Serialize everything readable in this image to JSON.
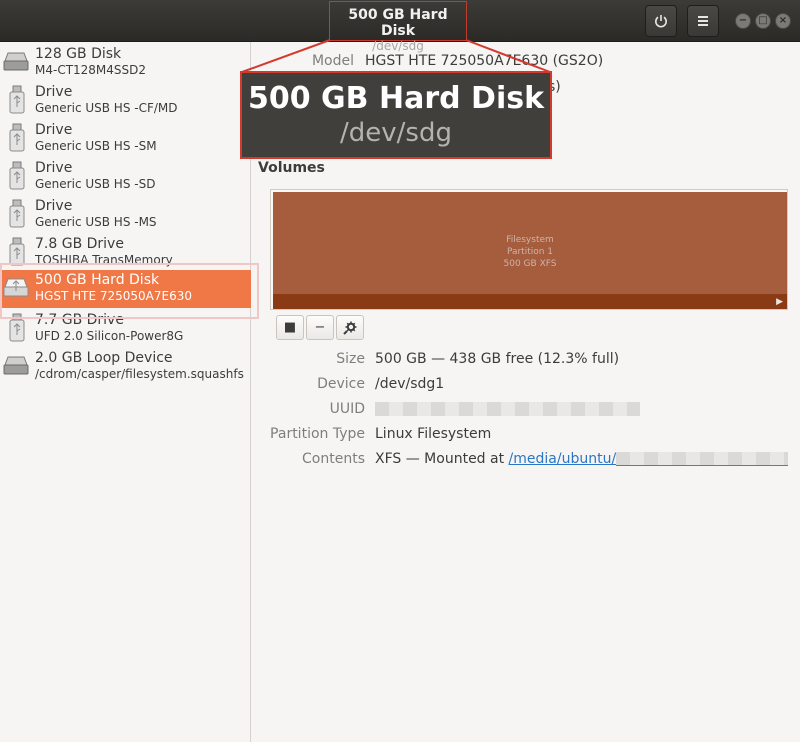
{
  "window": {
    "title": "500 GB Hard Disk",
    "subtitle": "/dev/sdg",
    "power_icon": "power-icon",
    "menu_icon": "hamburger-menu-icon",
    "minimize": "−",
    "maximize": "□",
    "close": "×"
  },
  "sidebar": {
    "devices": [
      {
        "name": "128 GB Disk",
        "model": "M4-CT128M4SSD2",
        "icon": "hard-disk-icon"
      },
      {
        "name": "Drive",
        "model": "Generic USB HS -CF/MD",
        "icon": "usb-drive-icon"
      },
      {
        "name": "Drive",
        "model": "Generic USB HS -SM",
        "icon": "usb-drive-icon"
      },
      {
        "name": "Drive",
        "model": "Generic USB HS -SD",
        "icon": "usb-drive-icon"
      },
      {
        "name": "Drive",
        "model": "Generic USB HS -MS",
        "icon": "usb-drive-icon"
      },
      {
        "name": "7.8 GB Drive",
        "model": "TOSHIBA TransMemory",
        "icon": "usb-drive-icon"
      },
      {
        "name": "500 GB Hard Disk",
        "model": "HGST HTE 725050A7E630",
        "icon": "hard-disk-icon",
        "selected": true
      },
      {
        "name": "7.7 GB Drive",
        "model": "UFD 2.0 Silicon-Power8G",
        "icon": "usb-drive-icon"
      },
      {
        "name": "2.0 GB Loop Device",
        "model": "/cdrom/casper/filesystem.squashfs",
        "icon": "hard-disk-icon"
      }
    ]
  },
  "details": {
    "model_label": "Model",
    "model_value": "HGST HTE 725050A7E630 (GS2O)",
    "hidden_fragment": "s)"
  },
  "volumes": {
    "heading": "Volumes",
    "partition": {
      "line1": "Filesystem",
      "line2": "Partition 1",
      "line3": "500 GB XFS"
    },
    "tools": {
      "stop": "■",
      "remove": "−",
      "settings_icon": "gear-icon"
    }
  },
  "partition_info": {
    "size_label": "Size",
    "size_value": "500 GB — 438 GB free (12.3% full)",
    "device_label": "Device",
    "device_value": "/dev/sdg1",
    "uuid_label": "UUID",
    "type_label": "Partition Type",
    "type_value": "Linux Filesystem",
    "contents_label": "Contents",
    "contents_prefix": "XFS — Mounted at ",
    "contents_link": "/media/ubuntu/"
  },
  "callout": {
    "title": "500 GB Hard Disk",
    "subtitle": "/dev/sdg"
  }
}
